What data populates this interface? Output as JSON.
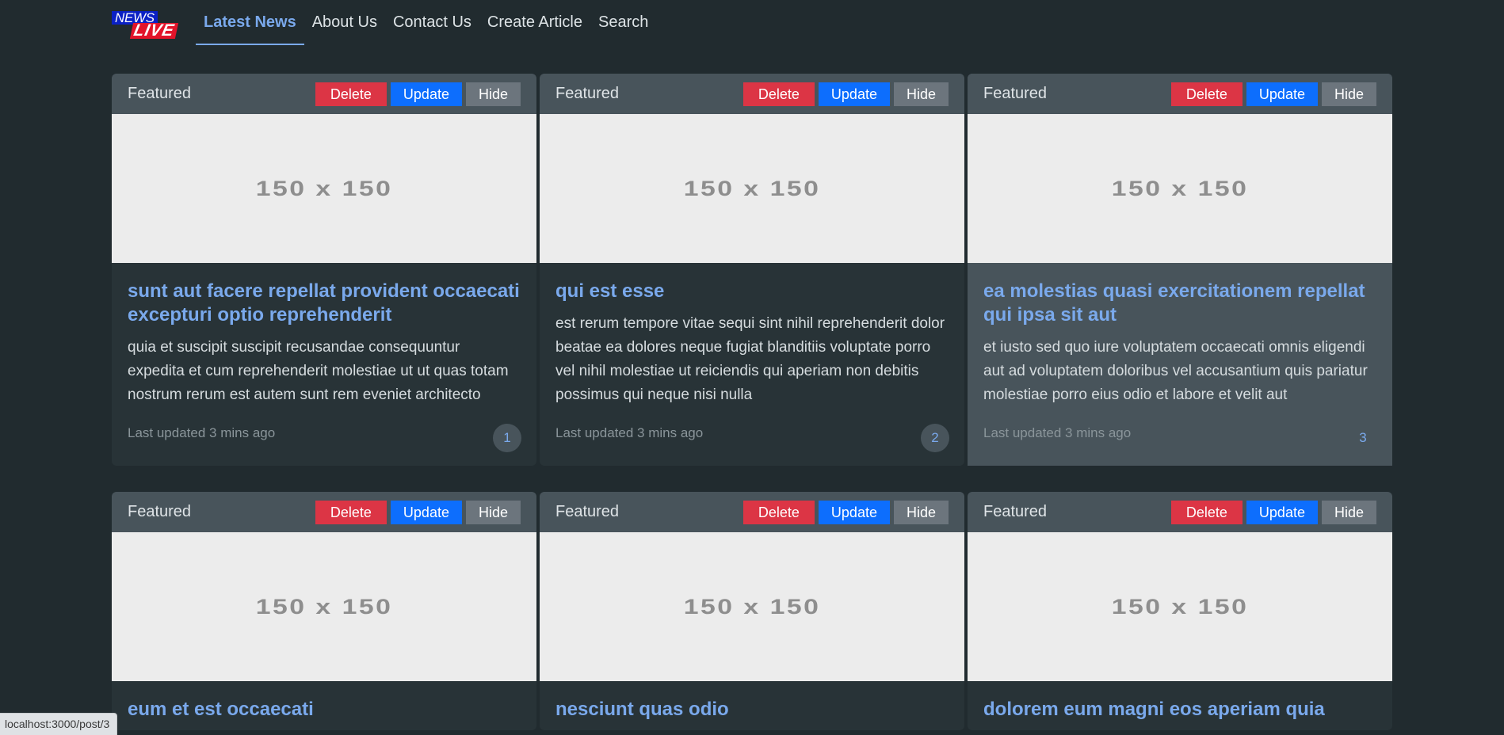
{
  "header": {
    "logo": {
      "line1": "NEWS",
      "line2": "LIVE"
    },
    "nav": [
      {
        "label": "Latest News",
        "active": true
      },
      {
        "label": "About Us"
      },
      {
        "label": "Contact Us"
      },
      {
        "label": "Create Article"
      },
      {
        "label": "Search"
      }
    ]
  },
  "card_common": {
    "featured_label": "Featured",
    "delete_label": "Delete",
    "update_label": "Update",
    "hide_label": "Hide",
    "image_placeholder": "150 x 150",
    "updated_text": "Last updated 3 mins ago"
  },
  "cards": [
    {
      "id": "1",
      "title": "sunt aut facere repellat provident occaecati excepturi optio reprehenderit",
      "body": "quia et suscipit suscipit recusandae consequuntur expedita et cum reprehenderit molestiae ut ut quas totam nostrum rerum est autem sunt rem eveniet architecto"
    },
    {
      "id": "2",
      "title": "qui est esse",
      "body": "est rerum tempore vitae sequi sint nihil reprehenderit dolor beatae ea dolores neque fugiat blanditiis voluptate porro vel nihil molestiae ut reiciendis qui aperiam non debitis possimus qui neque nisi nulla"
    },
    {
      "id": "3",
      "title": "ea molestias quasi exercitationem repellat qui ipsa sit aut",
      "body": "et iusto sed quo iure voluptatem occaecati omnis eligendi aut ad voluptatem doloribus vel accusantium quis pariatur molestiae porro eius odio et labore et velit aut",
      "hovered": true
    },
    {
      "title": "eum et est occaecati"
    },
    {
      "title": "nesciunt quas odio"
    },
    {
      "title": "dolorem eum magni eos aperiam quia"
    }
  ],
  "statusbar": {
    "url": "localhost:3000/post/3"
  }
}
